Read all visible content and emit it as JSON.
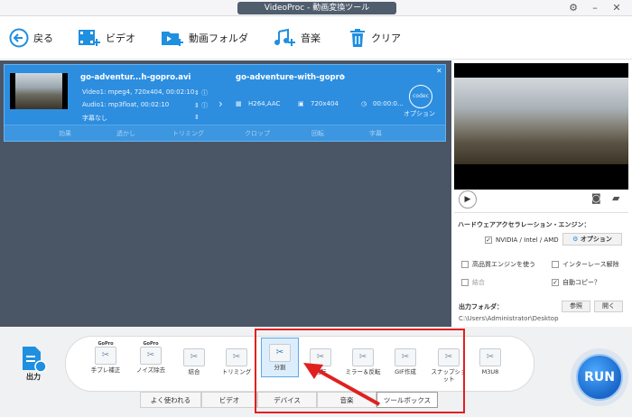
{
  "app": {
    "title": "VideoProc - 動画変換ツール"
  },
  "toolbar": {
    "back": "戻る",
    "video": "ビデオ",
    "folder": "動画フォルダ",
    "music": "音楽",
    "clear": "クリア"
  },
  "task": {
    "source_name": "go-adventur...h-gopro.avi",
    "video_info": "Video1: mpeg4, 720x404, 00:02:10",
    "audio_info": "Audio1: mp3float, 00:02:10",
    "subtitle": "字幕なし",
    "output_name": "go-adventure-with-gopro",
    "codec": "H264,AAC",
    "resolution": "720x404",
    "duration": "00:00:0...",
    "codec_badge": "codec",
    "option": "オプション",
    "edit_tools": [
      "効果",
      "透かし",
      "トリミング",
      "クロップ",
      "回転",
      "字幕"
    ]
  },
  "right": {
    "hw_title": "ハードウェアアクセラレーション・エンジン：",
    "nvidia": "NVIDIA / Intel / AMD",
    "option_btn": "オプション",
    "hq_engine": "高品質エンジンを使う",
    "deinterlace": "インターレース解除",
    "merge": "結合",
    "auto_copy": "自動コピー？",
    "output_folder_label": "出力フォルダ：",
    "browse": "参照",
    "open": "開く",
    "output_path": "C:\\Users\\Administrator\\Desktop"
  },
  "bottom": {
    "output_label": "出力",
    "tools": [
      "手ブレ補正",
      "ノイズ除去",
      "結合",
      "トリミング",
      "分割",
      "回転",
      "ミラー＆反転",
      "GIF作成",
      "スナップショット",
      "M3U8"
    ],
    "gopro": "GoPro",
    "tabs": [
      "よく使われる",
      "ビデオ",
      "デバイス",
      "音楽",
      "ツールボックス"
    ],
    "run": "RUN"
  }
}
